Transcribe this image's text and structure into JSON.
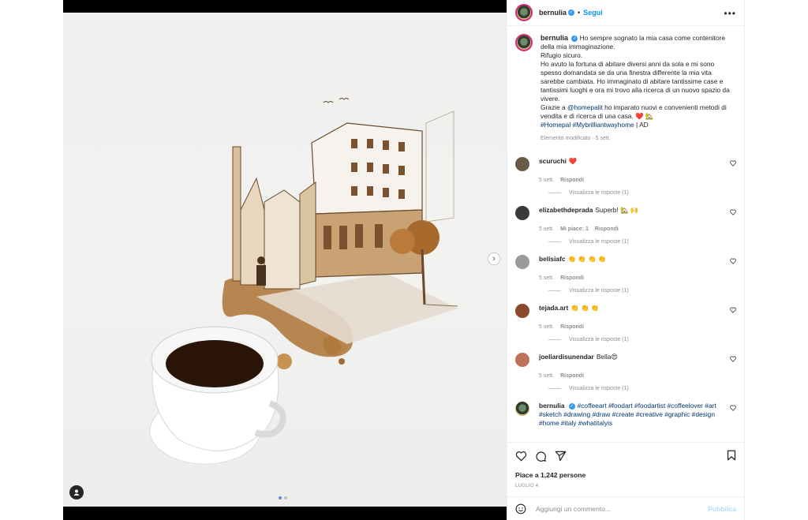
{
  "post": {
    "username": "bernulia",
    "follow_label": "Segui",
    "more_label": "•••"
  },
  "caption": {
    "username": "bernulia",
    "line1": "Ho sempre sognato la mia casa come contenitore della mia immaginazione.",
    "line2": "Rifugio sicuro.",
    "line3": "Ho avuto la fortuna di abitare diversi anni da sola e mi sono spesso domandata se da una finestra differente la mia vita sarebbe cambiata. Ho immaginato di abitare tantissime case e tantissimi luoghi e ora mi trovo alla ricerca di un nuovo spazio da vivere.",
    "line4_pre": "Grazie a ",
    "mention": "@homepalit",
    "line4_post": " ho imparato nuovi e convenienti metodi di vendita e di ricerca di una casa. ❤️ 🏡",
    "hashtags": "#Homepal #Mybrilliantwayhome",
    "suffix": " | AD",
    "meta": "Elemento modificato · 5 sett."
  },
  "comments": [
    {
      "user": "scuruchi",
      "text": "❤️",
      "time": "5 sett.",
      "likes": "",
      "reply": "Rispondi",
      "replies": "Visualizza le risposte (1)",
      "avatar_color": "#6b5a4a"
    },
    {
      "user": "elizabethdeprada",
      "text": "Superb! 🏡 🙌",
      "time": "5 sett.",
      "likes": "Mi piace: 1",
      "reply": "Rispondi",
      "replies": "Visualizza le risposte (1)",
      "avatar_color": "#3a3a3a"
    },
    {
      "user": "belisiafc",
      "text": "👏 👏 👏 👏",
      "time": "5 sett.",
      "likes": "",
      "reply": "Rispondi",
      "replies": "Visualizza le risposte (1)",
      "avatar_color": "#9a9a9a"
    },
    {
      "user": "tejada.art",
      "text": "👏 👏 👏",
      "time": "5 sett.",
      "likes": "",
      "reply": "Rispondi",
      "replies": "Visualizza le risposte (1)",
      "avatar_color": "#8b4a2b"
    },
    {
      "user": "joeliardisunendar",
      "text": "Bella😍",
      "time": "5 sett.",
      "likes": "",
      "reply": "Rispondi",
      "replies": "Visualizza le risposte (1)",
      "avatar_color": "#c0705a"
    }
  ],
  "last_comment": {
    "user": "bernulia",
    "text": "#coffeeart #foodart #foodartist #coffeelover #art #sketch #drawing #draw #create #creative #graphic #design #home #italy #whatitalyis"
  },
  "actions": {
    "likes": "Piace a 1,242 persone",
    "date": "LUGLIO 4"
  },
  "composer": {
    "placeholder": "Aggiungi un commento...",
    "publish": "Pubblica"
  }
}
